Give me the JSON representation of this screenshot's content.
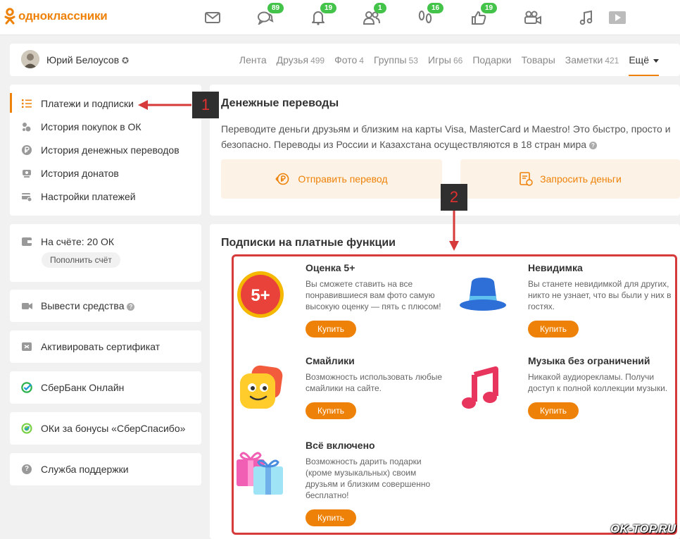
{
  "brand": {
    "logo_text": "одноклассники",
    "accent": "#ee8208",
    "badge_color": "#44c34a"
  },
  "topnav": [
    {
      "icon": "mail-icon",
      "badge": ""
    },
    {
      "icon": "chat-icon",
      "badge": "89"
    },
    {
      "icon": "bell-icon",
      "badge": "19"
    },
    {
      "icon": "friends-icon",
      "badge": "1"
    },
    {
      "icon": "footprints-icon",
      "badge": "16"
    },
    {
      "icon": "thumbs-up-icon",
      "badge": "19"
    },
    {
      "icon": "video-camera-icon",
      "badge": ""
    },
    {
      "icon": "music-note-icon",
      "badge": ""
    },
    {
      "icon": "play-video-icon",
      "badge": ""
    }
  ],
  "profile": {
    "name": "Юрий Белоусов",
    "tabs": [
      {
        "label": "Лента",
        "count": ""
      },
      {
        "label": "Друзья",
        "count": "499"
      },
      {
        "label": "Фото",
        "count": "4"
      },
      {
        "label": "Группы",
        "count": "53"
      },
      {
        "label": "Игры",
        "count": "66"
      },
      {
        "label": "Подарки",
        "count": ""
      },
      {
        "label": "Товары",
        "count": ""
      },
      {
        "label": "Заметки",
        "count": "421"
      }
    ],
    "more_label": "Ещё"
  },
  "payments_menu": [
    {
      "icon": "list-icon",
      "label": "Платежи и подписки"
    },
    {
      "icon": "purchase-history-icon",
      "label": "История покупок в ОК"
    },
    {
      "icon": "ruble-icon",
      "label": "История денежных переводов"
    },
    {
      "icon": "donation-icon",
      "label": "История донатов"
    },
    {
      "icon": "payment-settings-icon",
      "label": "Настройки платежей"
    }
  ],
  "balance": {
    "label": "На счёте: 20 ОК",
    "topup_label": "Пополнить счёт"
  },
  "side_links": [
    {
      "icon": "withdraw-icon",
      "label": "Вывести средства",
      "help": "?"
    },
    {
      "icon": "certificate-icon",
      "label": "Активировать сертификат"
    },
    {
      "icon": "sberbank-icon",
      "label": "СберБанк Онлайн"
    },
    {
      "icon": "sberspasibo-icon",
      "label": "ОКи за бонусы «СберСпасибо»"
    },
    {
      "icon": "help-icon",
      "label": "Служба поддержки"
    }
  ],
  "transfers": {
    "title": "Денежные переводы",
    "desc": "Переводите деньги друзьям и близким на карты Visa, MasterCard и Maestro! Это быстро, просто и безопасно. Переводы из России и Казахстана осуществляются в 18 стран мира",
    "send_label": "Отправить перевод",
    "request_label": "Запросить деньги"
  },
  "subscriptions": {
    "title": "Подписки на платные функции",
    "buy_label": "Купить",
    "items": [
      {
        "name": "Оценка 5+",
        "desc": [
          "Вы сможете ставить на все",
          "понравившиеся вам фото самую",
          "высокую оценку — пять с плюсом!"
        ],
        "icon": "five-plus-icon",
        "icon_text": "5+"
      },
      {
        "name": "Невидимка",
        "desc": [
          "Вы станете невидимкой для других,",
          "никто не узнает, что вы были у них в",
          "гостях."
        ],
        "icon": "invisible-hat-icon"
      },
      {
        "name": "Смайлики",
        "desc": [
          "Возможность использовать любые",
          "смайлики на сайте."
        ],
        "icon": "smiley-icon"
      },
      {
        "name": "Музыка без ограничений",
        "desc": [
          "Никакой аудиорекламы. Получи",
          "доступ к полной коллекции музыки."
        ],
        "icon": "music-icon"
      },
      {
        "name": "Всё включено",
        "desc": [
          "Возможность дарить подарки",
          "(кроме музыкальных) своим",
          "друзьям и близким совершенно",
          "бесплатно!"
        ],
        "icon": "gift-boxes-icon"
      }
    ]
  },
  "annotations": {
    "marker1": "1",
    "marker2": "2",
    "annotation_color": "#d63a3a"
  },
  "watermark": "OK-TOP.RU"
}
